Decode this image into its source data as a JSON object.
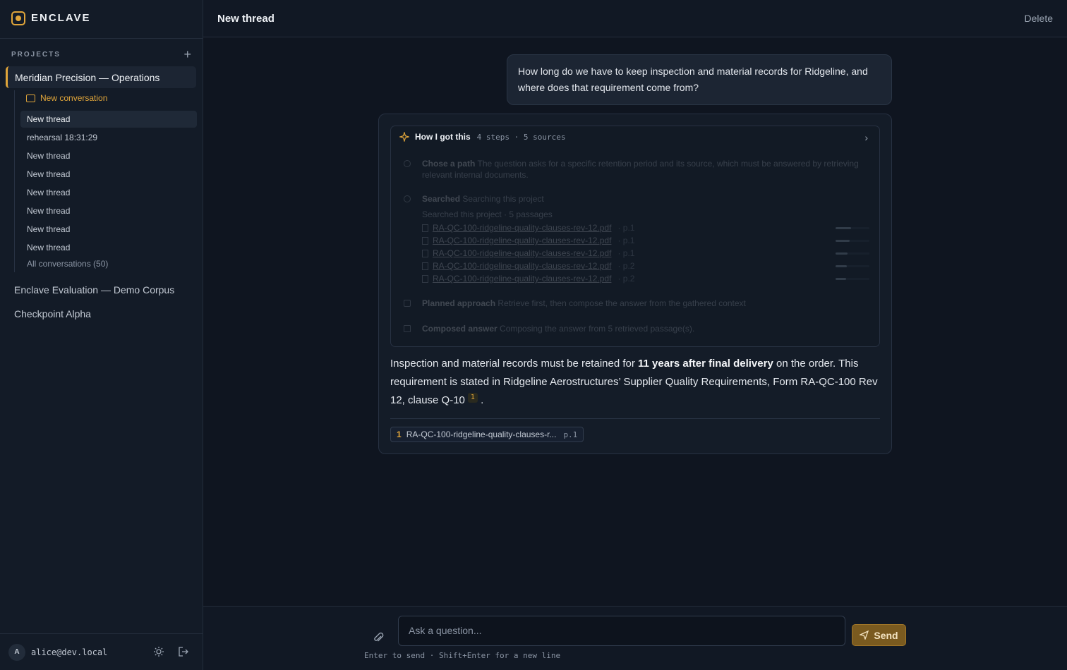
{
  "brand": {
    "name": "ENCLAVE",
    "accent": "#e0a53a"
  },
  "sidebar": {
    "projects_label": "PROJECTS",
    "active_project": "Meridian Precision — Operations",
    "new_conversation": "New conversation",
    "threads": [
      {
        "label": "New thread",
        "active": true
      },
      {
        "label": "rehearsal 18:31:29"
      },
      {
        "label": "New thread"
      },
      {
        "label": "New thread"
      },
      {
        "label": "New thread"
      },
      {
        "label": "New thread"
      },
      {
        "label": "New thread"
      },
      {
        "label": "New thread"
      }
    ],
    "all_conversations": "All conversations (50)",
    "other_projects": [
      "Enclave Evaluation — Demo Corpus",
      "Checkpoint Alpha"
    ],
    "user_initial": "A",
    "user_email": "alice@dev.local"
  },
  "topbar": {
    "title": "New thread",
    "delete": "Delete"
  },
  "conversation": {
    "question": "How long do we have to keep inspection and material records for Ridgeline, and where does that requirement come from?",
    "how": {
      "title": "How I got this",
      "meta": "4 steps · 5 sources",
      "step1_title": "Chose a path",
      "step1_text": "The question asks for a specific retention period and its source, which must be answered by retrieving relevant internal documents.",
      "step2_title": "Searched",
      "step2_text": "Searching this project",
      "step2_sub": "Searched this project · 5 passages",
      "sources": [
        {
          "file": "RA-QC-100-ridgeline-quality-clauses-rev-12.pdf",
          "page": "· p.1",
          "score": 0.45
        },
        {
          "file": "RA-QC-100-ridgeline-quality-clauses-rev-12.pdf",
          "page": "· p.1",
          "score": 0.42
        },
        {
          "file": "RA-QC-100-ridgeline-quality-clauses-rev-12.pdf",
          "page": "· p.1",
          "score": 0.35
        },
        {
          "file": "RA-QC-100-ridgeline-quality-clauses-rev-12.pdf",
          "page": "· p.2",
          "score": 0.33
        },
        {
          "file": "RA-QC-100-ridgeline-quality-clauses-rev-12.pdf",
          "page": "· p.2",
          "score": 0.32
        }
      ],
      "step3_title": "Planned approach",
      "step3_text": "Retrieve first, then compose the answer from the gathered context",
      "step4_title": "Composed answer",
      "step4_text": "Composing the answer from 5 retrieved passage(s)."
    },
    "answer_a": "Inspection and material records must be retained for ",
    "answer_bold": "11 years after final delivery",
    "answer_b": " on the order. This requirement is stated in Ridgeline Aerostructures’ Supplier Quality Requirements, Form RA-QC-100 Rev 12, clause Q-10",
    "answer_cite": "1",
    "answer_end": ".",
    "citation": {
      "num": "1",
      "file": "RA-QC-100-ridgeline-quality-clauses-r...",
      "page": "p.1"
    }
  },
  "composer": {
    "placeholder": "Ask a question...",
    "send": "Send",
    "hint": "Enter to send · Shift+Enter for a new line"
  }
}
